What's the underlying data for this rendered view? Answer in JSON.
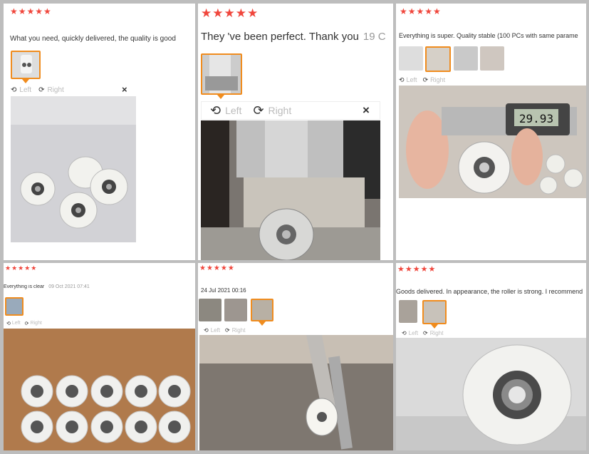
{
  "reviews": [
    {
      "stars": "★★★★★",
      "text": "What you need, quickly delivered, the quality is good",
      "date": "",
      "left": "Left",
      "right": "Right",
      "close": "×"
    },
    {
      "stars": "★★★★★",
      "text": "They 've been perfect. Thank you",
      "date": "19 C",
      "left": "Left",
      "right": "Right",
      "close": "×"
    },
    {
      "stars": "★★★★★",
      "text": "Everything is super. Quality stable (100 PCs with same parame",
      "date": "",
      "left": "Left",
      "right": "Right"
    },
    {
      "stars": "★★★★★",
      "text": "Everything is clear",
      "date": "09 Oct 2021 07:41",
      "left": "Left",
      "right": "Right"
    },
    {
      "stars": "★★★★★",
      "text": "",
      "date": "24 Jul 2021 00:16",
      "left": "Left",
      "right": "Right"
    },
    {
      "stars": "★★★★★",
      "text": "Goods delivered. In appearance, the roller is strong. I recommend",
      "date": "",
      "left": "Left",
      "right": "Right"
    }
  ],
  "caliper_reading": "29.93",
  "colors": {
    "star": "#f0463c",
    "selected": "#f08c1e"
  }
}
